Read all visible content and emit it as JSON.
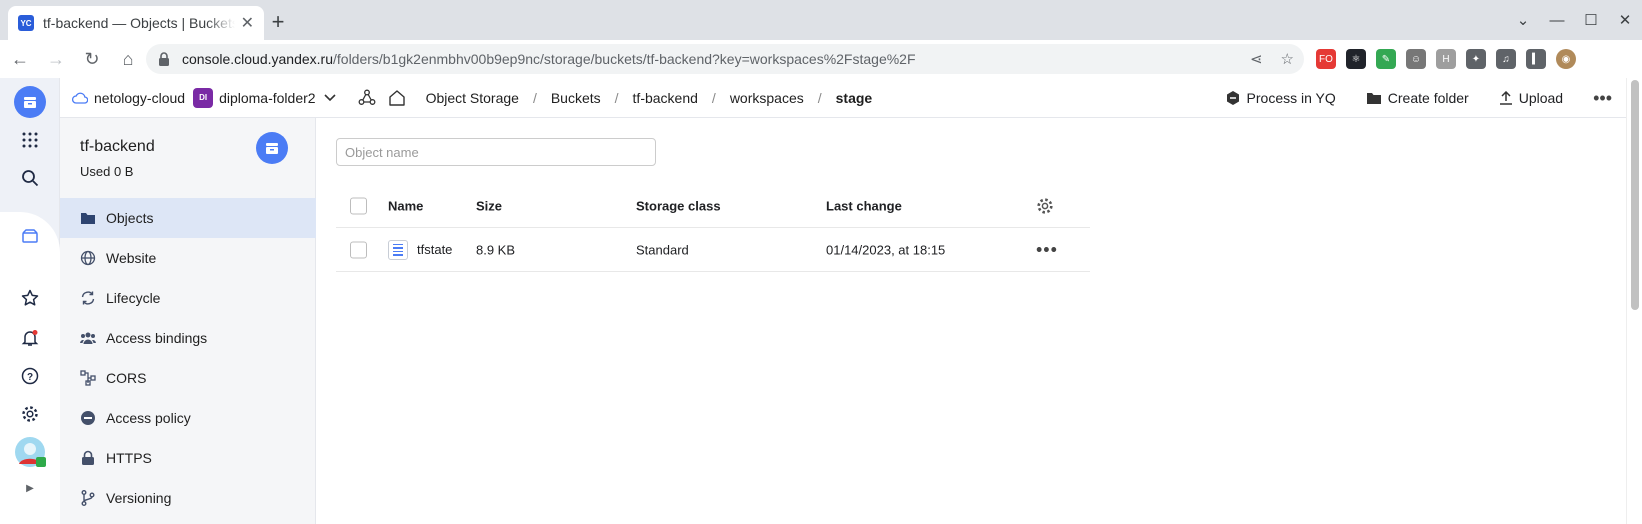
{
  "browser": {
    "tab_title": "tf-backend — Objects | Buckets",
    "tab_favicon": "YC",
    "url_host": "console.cloud.yandex.ru",
    "url_path": "/folders/b1gk2enmbhv00b9ep9nc/storage/buckets/tf-backend?key=workspaces%2Fstage%2F",
    "extensions": [
      {
        "name": "fo-extension-icon",
        "label": "FO",
        "color": "#e53935"
      },
      {
        "name": "react-devtools-icon",
        "label": "⚛",
        "color": "#20232a"
      },
      {
        "name": "edit-extension-icon",
        "label": "✎",
        "color": "#34a853"
      },
      {
        "name": "robot-extension-icon",
        "label": "☺",
        "color": "#777777"
      },
      {
        "name": "h-extension-icon",
        "label": "H",
        "color": "#9e9e9e"
      },
      {
        "name": "puzzle-icon",
        "label": "✦",
        "color": "#5f6368"
      },
      {
        "name": "media-icon",
        "label": "♫",
        "color": "#5f6368"
      },
      {
        "name": "sidepanel-icon",
        "label": "▍",
        "color": "#5f6368"
      },
      {
        "name": "profile-avatar",
        "label": "◉",
        "color": "#b08a5a"
      }
    ]
  },
  "topbar": {
    "cloud": "netology-cloud",
    "folder_badge": "DI",
    "folder": "diploma-folder2",
    "breadcrumbs": [
      "Object Storage",
      "Buckets",
      "tf-backend",
      "workspaces",
      "stage"
    ],
    "actions": {
      "process": "Process in YQ",
      "create_folder": "Create folder",
      "upload": "Upload"
    }
  },
  "sidebar": {
    "bucket_name": "tf-backend",
    "used": "Used 0 B",
    "items": [
      {
        "label": "Objects",
        "icon": "folder-icon"
      },
      {
        "label": "Website",
        "icon": "globe-icon"
      },
      {
        "label": "Lifecycle",
        "icon": "cycle-icon"
      },
      {
        "label": "Access bindings",
        "icon": "people-icon"
      },
      {
        "label": "CORS",
        "icon": "cors-icon"
      },
      {
        "label": "Access policy",
        "icon": "minus-circle-icon"
      },
      {
        "label": "HTTPS",
        "icon": "lock-icon"
      },
      {
        "label": "Versioning",
        "icon": "branch-icon"
      }
    ]
  },
  "main": {
    "search_placeholder": "Object name",
    "columns": {
      "name": "Name",
      "size": "Size",
      "storage_class": "Storage class",
      "last_change": "Last change"
    },
    "rows": [
      {
        "name": "tfstate",
        "size": "8.9 KB",
        "storage_class": "Standard",
        "last_change": "01/14/2023, at 18:15"
      }
    ]
  }
}
